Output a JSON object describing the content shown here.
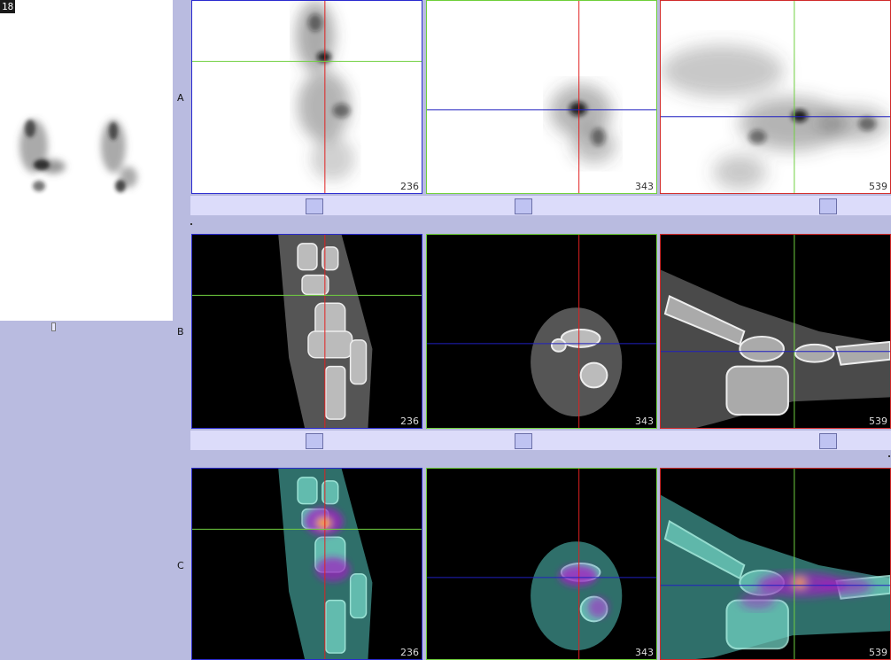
{
  "thumbnail": {
    "badge": "18"
  },
  "rows": [
    {
      "label": "A",
      "slices": [
        "236",
        "343",
        "539"
      ]
    },
    {
      "label": "B",
      "slices": [
        "236",
        "343",
        "539"
      ]
    },
    {
      "label": "C",
      "slices": [
        "236",
        "343",
        "539"
      ]
    }
  ],
  "colors": {
    "background": "#b9bbe0",
    "strip": "#dcdcfa",
    "border_coronal": "#2a2acf",
    "border_axial": "#6fcf3a",
    "border_sagittal": "#d02a2a",
    "crosshair_red": "#e02020",
    "crosshair_green": "#70d040",
    "crosshair_blue": "#2020c0"
  }
}
